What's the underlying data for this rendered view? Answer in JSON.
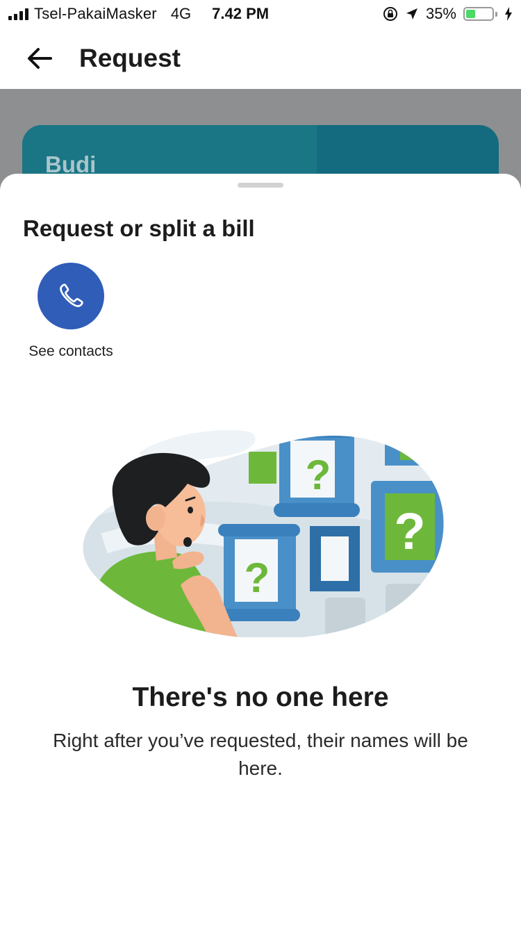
{
  "status_bar": {
    "carrier": "Tsel-PakaiMasker",
    "network": "4G",
    "time": "7.42 PM",
    "battery": "35%",
    "battery_level": 0.35
  },
  "header": {
    "title": "Request"
  },
  "background_card": {
    "name": "Budi"
  },
  "sheet": {
    "title": "Request or split a bill",
    "contacts_label": "See contacts"
  },
  "empty_state": {
    "title": "There's no one here",
    "description": "Right after you’ve requested, their names will be here."
  },
  "colors": {
    "accent_blue": "#2f5db8",
    "teal": "#146b7f",
    "green": "#6db83a",
    "battery_green": "#4cd964"
  }
}
